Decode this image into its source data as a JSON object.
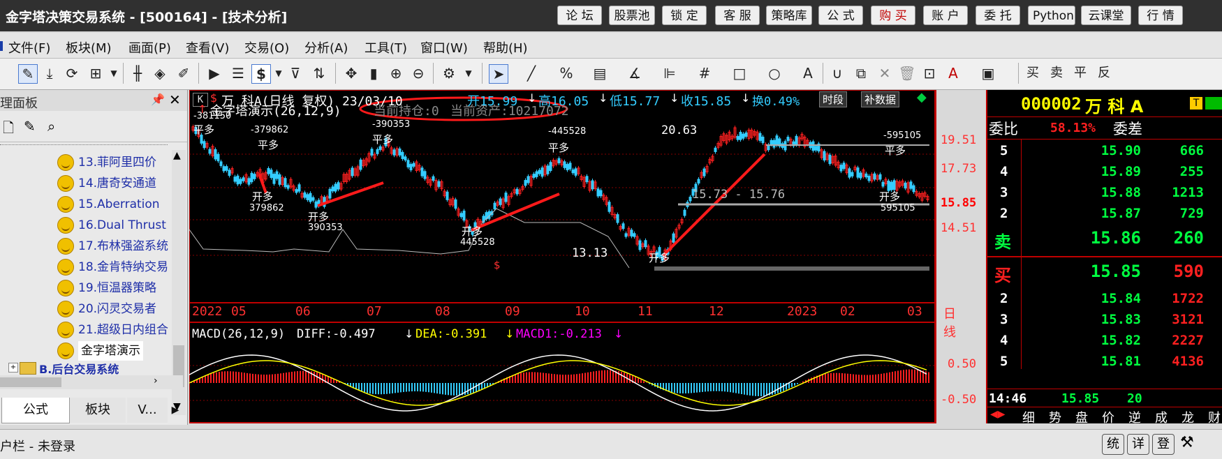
{
  "titlebar": {
    "title": "金字塔决策交易系统 - [500164] - [技术分析]",
    "buttons": [
      "论 坛",
      "股票池",
      "锁 定",
      "客 服",
      "策略库",
      "公 式",
      "购 买",
      "账 户",
      "委 托",
      "Python",
      "云课堂",
      "行 情"
    ]
  },
  "menu": [
    "文件(F)",
    "板块(M)",
    "画面(P)",
    "查看(V)",
    "交易(O)",
    "分析(A)",
    "工具(T)",
    "窗口(W)",
    "帮助(H)"
  ],
  "toolbar": {
    "trade_labels": [
      "买",
      "卖",
      "平",
      "反"
    ]
  },
  "left_panel": {
    "title": "理面板",
    "tree_items": [
      "13.菲阿里四价",
      "14.唐奇安通道",
      "15.Aberration",
      "16.Dual Thrust",
      "17.布林强盗系统",
      "18.金肯特纳交易",
      "19.恒温器策略",
      "20.闪灵交易者",
      "21.超级日内组合",
      "金字塔演示"
    ],
    "folder": "B.后台交易系统",
    "tabs": [
      "公式",
      "板块",
      "V..."
    ]
  },
  "chart": {
    "header": {
      "period_btn": "K",
      "name": "万  科A(日线 复权) 23/03/10",
      "open": "开15.99",
      "high": "高16.05",
      "low": "低15.77",
      "close": "收15.85",
      "turnover": "换0.49%",
      "btn_period": "时段",
      "btn_supplement": "补数据"
    },
    "strategy_line": "金字塔演示(26,12,9)",
    "position_label": "当前持仓:0",
    "asset_label": "当前资产:10217072",
    "annotations": {
      "signals": [
        "平多",
        "开多",
        "平多",
        "开多",
        "平多",
        "开多",
        "平多",
        "开多",
        "平多",
        "开多"
      ],
      "numbers": [
        "-381150",
        "-379862",
        "379862",
        "-390353",
        "390353",
        "-445528",
        "445528",
        "-595105",
        "595105"
      ],
      "high_label": "20.63",
      "low_label": "13.13",
      "range_label": "15.73 - 15.76",
      "dollar": "$"
    },
    "price_axis": [
      "19.51",
      "17.73",
      "15.85",
      "14.51"
    ],
    "current_price": "15.85",
    "date_axis": [
      "2022",
      "05",
      "06",
      "07",
      "08",
      "09",
      "10",
      "11",
      "12",
      "2023",
      "02",
      "03"
    ],
    "date_mode": "日线",
    "macd": {
      "label": "MACD(26,12,9)",
      "diff": "DIFF:-0.497",
      "dea": "DEA:-0.391",
      "macd1": "MACD1:-0.213",
      "axis": [
        "0.50",
        "-0.50"
      ]
    }
  },
  "quote": {
    "code": "000002",
    "name": "万 科 A",
    "badge": "T",
    "wb_label": "委比",
    "wb_value": "58.13%",
    "wc_label": "委差",
    "asks": [
      {
        "lvl": "5",
        "price": "15.90",
        "vol": "666"
      },
      {
        "lvl": "4",
        "price": "15.89",
        "vol": "255"
      },
      {
        "lvl": "3",
        "price": "15.88",
        "vol": "1213"
      },
      {
        "lvl": "2",
        "price": "15.87",
        "vol": "729"
      }
    ],
    "sell1": {
      "lvl": "卖",
      "price": "15.86",
      "vol": "260"
    },
    "buy1": {
      "lvl": "买",
      "price": "15.85",
      "vol": "590"
    },
    "bids": [
      {
        "lvl": "2",
        "price": "15.84",
        "vol": "1722"
      },
      {
        "lvl": "3",
        "price": "15.83",
        "vol": "3121"
      },
      {
        "lvl": "4",
        "price": "15.82",
        "vol": "2227"
      },
      {
        "lvl": "5",
        "price": "15.81",
        "vol": "4136"
      }
    ],
    "last_time": "14:46",
    "last_price": "15.85",
    "last_vol": "20",
    "tabs": [
      "细",
      "势",
      "盘",
      "价",
      "逆",
      "成",
      "龙",
      "财"
    ]
  },
  "status": {
    "left": "户栏 - 未登录",
    "buttons": [
      "统",
      "详",
      "登"
    ]
  },
  "colors": {
    "red": "#ff2020",
    "green": "#00ff40",
    "cyan": "#33ccff",
    "chart_bg": "#000000",
    "frame": "#c00000"
  }
}
